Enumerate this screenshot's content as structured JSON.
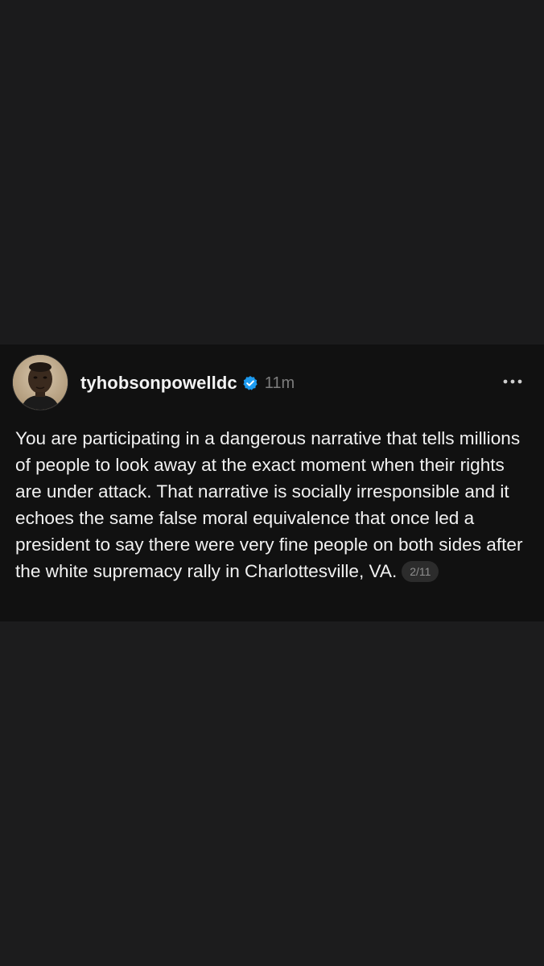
{
  "post": {
    "username": "tyhobsonpowelldc",
    "verified": true,
    "timestamp": "11m",
    "text": "You are participating in a dangerous narrative that tells millions of people to look away at the exact moment when their rights are under attack. That narrative is socially irresponsible and it echoes the same false moral equivalence that once led a president to say there were very fine people on both sides after the white supremacy rally in Charlottesville, VA.",
    "thread_position": "2/11",
    "icons": {
      "verified": "verified-badge-icon",
      "more": "more-options-icon"
    }
  },
  "colors": {
    "background": "#1c1c1d",
    "card": "#111111",
    "verified_blue": "#1d9bf0",
    "text": "#f1f1f1",
    "muted": "#7d7d7d"
  }
}
